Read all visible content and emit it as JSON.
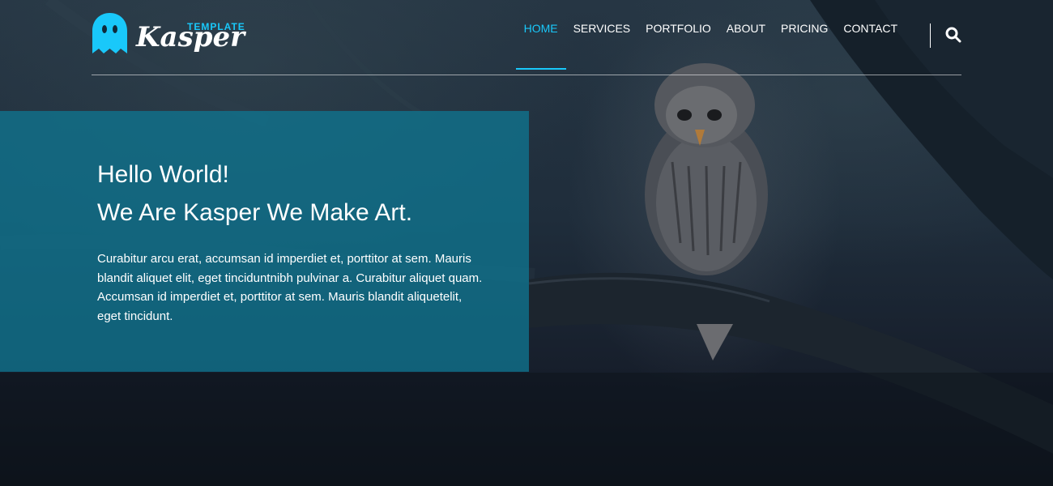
{
  "brand": {
    "name": "Kasper",
    "tag": "TEMPLATE",
    "logo_icon": "ghost-icon",
    "accent_color": "#19c8fa"
  },
  "nav": {
    "items": [
      {
        "label": "HOME",
        "active": true
      },
      {
        "label": "SERVICES",
        "active": false
      },
      {
        "label": "PORTFOLIO",
        "active": false
      },
      {
        "label": "ABOUT",
        "active": false
      },
      {
        "label": "PRICING",
        "active": false
      },
      {
        "label": "CONTACT",
        "active": false
      }
    ],
    "search_icon": "search-icon"
  },
  "intro": {
    "line1": "Hello World!",
    "line2": "We Are Kasper We Make Art.",
    "paragraph": "Curabitur arcu erat, accumsan id imperdiet et, porttitor at sem. Mauris blandit aliquet elit, eget tinciduntnibh pulvinar a. Curabitur aliquet quam. Accumsan id imperdiet et, porttitor at sem. Mauris blandit aliquetelit, eget tincidunt.",
    "box_color": "#0f748f"
  }
}
